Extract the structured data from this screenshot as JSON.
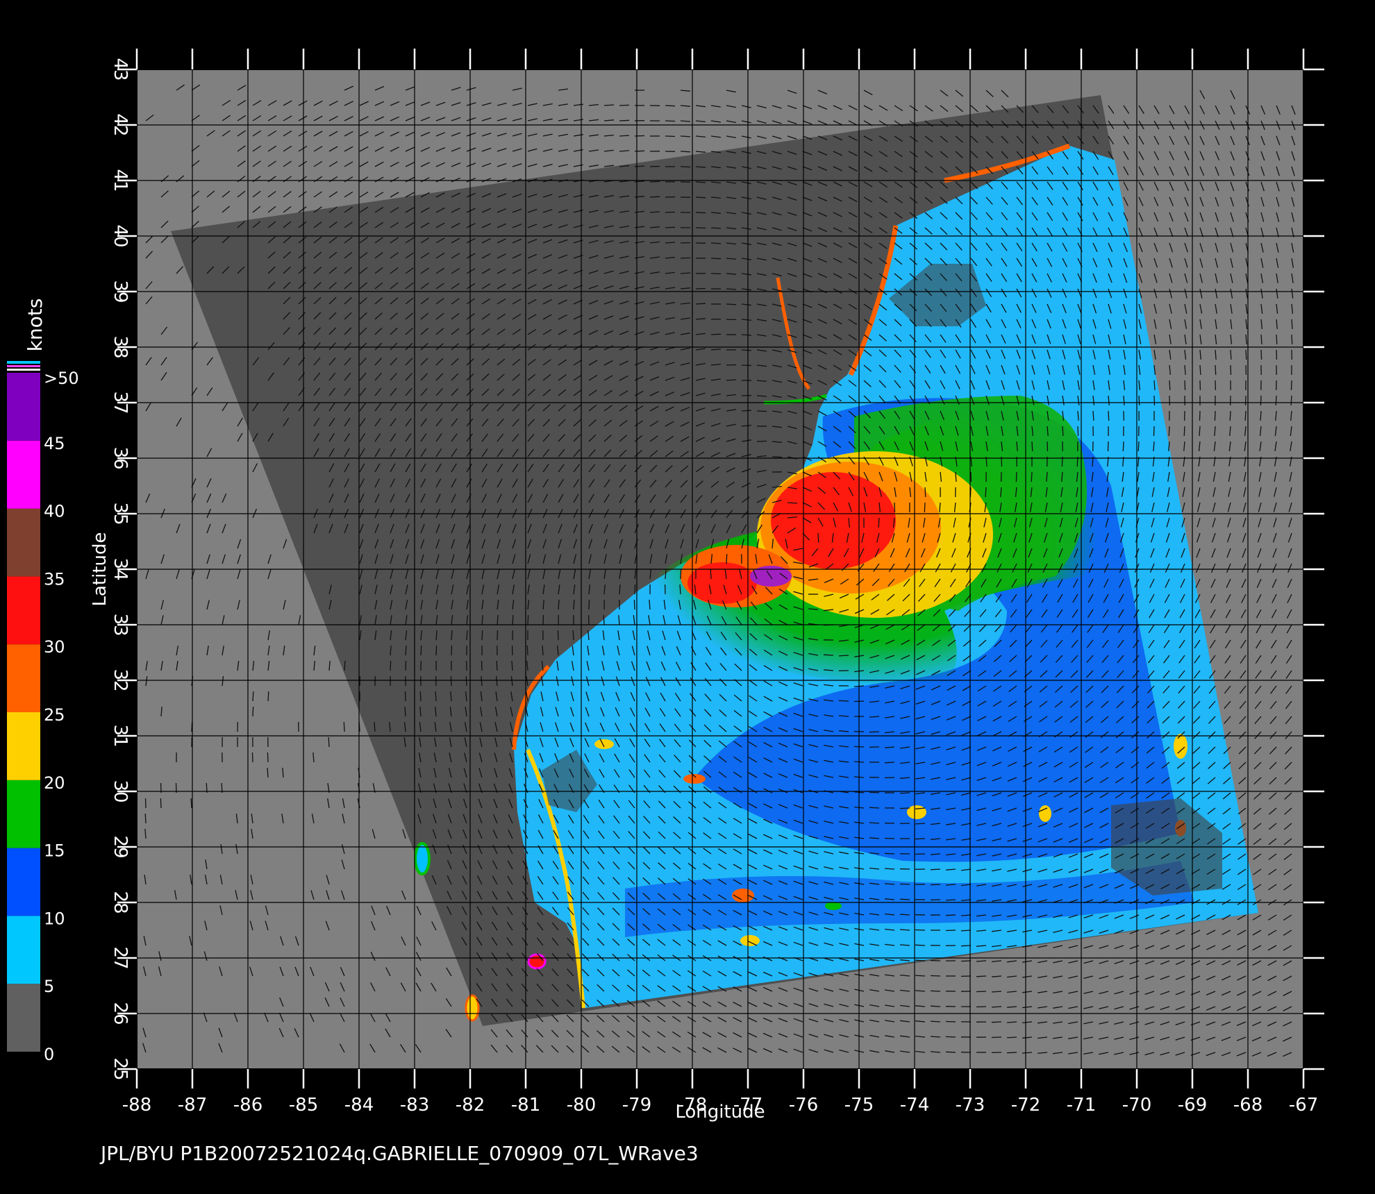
{
  "map": {
    "x_axis_label": "Longitude",
    "y_axis_label": "Latitude",
    "lon_range": [
      -88,
      -67
    ],
    "lat_range": [
      25,
      43
    ],
    "lon_ticks": [
      "-88",
      "-87",
      "-86",
      "-85",
      "-84",
      "-83",
      "-82",
      "-81",
      "-80",
      "-79",
      "-78",
      "-77",
      "-76",
      "-75",
      "-74",
      "-73",
      "-72",
      "-71",
      "-70",
      "-69",
      "-68",
      "-67"
    ],
    "lat_ticks": [
      "25",
      "26",
      "27",
      "28",
      "29",
      "30",
      "31",
      "32",
      "33",
      "34",
      "35",
      "36",
      "37",
      "38",
      "39",
      "40",
      "41",
      "42",
      "43"
    ],
    "grid": true,
    "background_color": "#808080",
    "swath_color": "#505050",
    "land_color": "#4a4a4a"
  },
  "colorbar": {
    "unit_label": "knots",
    "tick_labels": [
      "0",
      "5",
      "10",
      "15",
      "20",
      "25",
      "30",
      "35",
      "40",
      "45",
      ">50"
    ],
    "colors": {
      "0-5": "#606060",
      "5-10": "#00c8ff",
      "10-15": "#0050ff",
      "15-20": "#00c000",
      "20-25": "#ffd000",
      "25-30": "#ff6000",
      "30-35": "#ff1010",
      "35-40": "#804030",
      "40-45": "#ff00ff",
      "45-50": "#8000c0"
    }
  },
  "footer": {
    "text": "JPL/BYU  P1B20072521024q.GABRIELLE_070909_07L_WRave3"
  }
}
